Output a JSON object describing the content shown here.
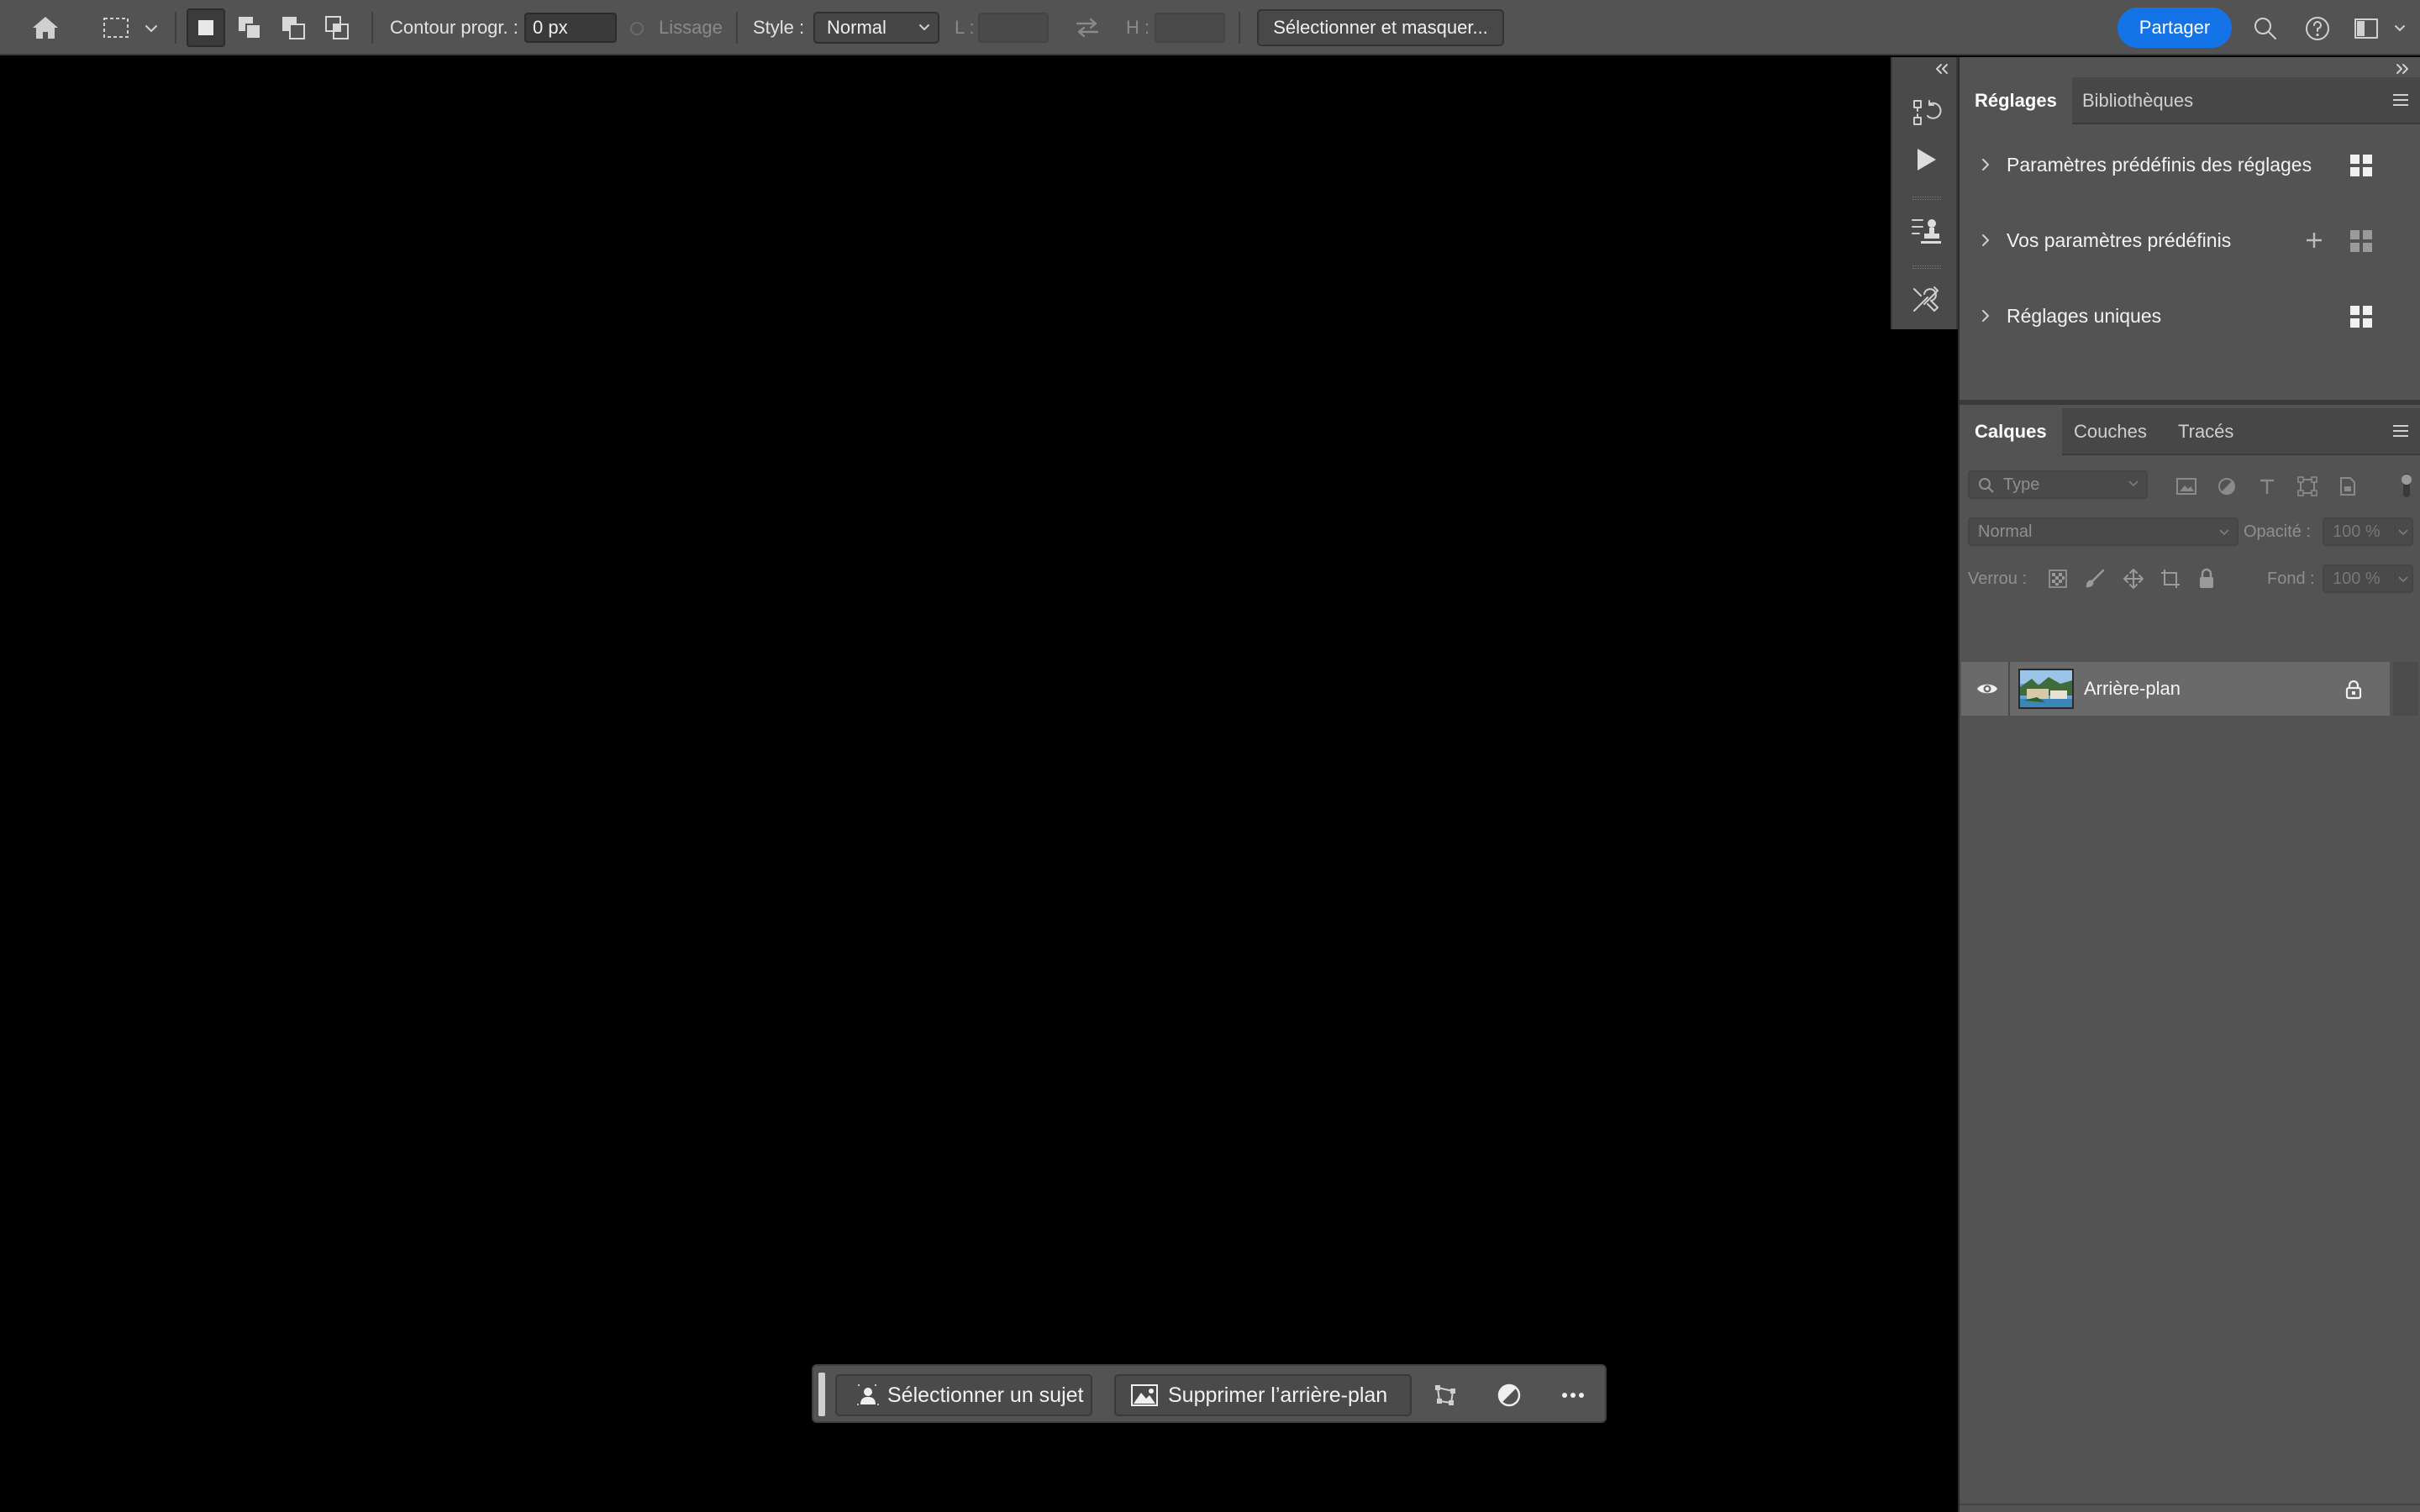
{
  "options_bar": {
    "feather_label": "Contour progr. :",
    "feather_value": "0 px",
    "antialias_label": "Lissage",
    "style_label": "Style :",
    "style_value": "Normal",
    "width_label": "L :",
    "height_label": "H :",
    "select_mask_label": "Sélectionner et masquer...",
    "share_label": "Partager"
  },
  "adjustments_panel": {
    "tabs": [
      "Réglages",
      "Bibliothèques"
    ],
    "rows": [
      {
        "label": "Paramètres prédéfinis des réglages"
      },
      {
        "label": "Vos paramètres prédéfinis"
      },
      {
        "label": "Réglages uniques"
      }
    ]
  },
  "layers_panel": {
    "tabs": [
      "Calques",
      "Couches",
      "Tracés"
    ],
    "filter_placeholder": "Type",
    "blend_mode": "Normal",
    "opacity_label": "Opacité :",
    "opacity_value": "100 %",
    "lock_label": "Verrou :",
    "fill_label": "Fond :",
    "fill_value": "100 %",
    "layers": [
      {
        "name": "Arrière-plan",
        "visible": true,
        "locked": true
      }
    ]
  },
  "task_bar": {
    "select_subject": "Sélectionner un sujet",
    "remove_background": "Supprimer l’arrière-plan"
  },
  "colors": {
    "accent": "#1473e6",
    "panel_bg": "#535353",
    "canvas_bg": "#000000"
  }
}
